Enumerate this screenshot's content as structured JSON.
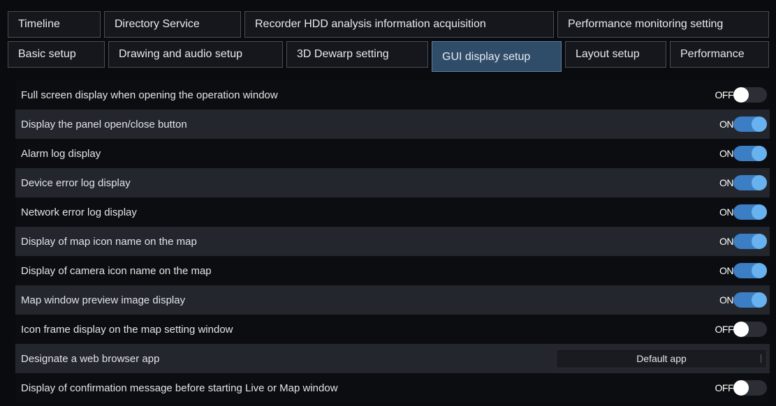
{
  "tabs_row1": [
    {
      "label": "Timeline"
    },
    {
      "label": "Directory Service"
    },
    {
      "label": "Recorder HDD analysis information acquisition"
    },
    {
      "label": "Performance monitoring setting"
    }
  ],
  "tabs_row2": [
    {
      "label": "Basic setup"
    },
    {
      "label": "Drawing and audio setup"
    },
    {
      "label": "3D Dewarp setting"
    },
    {
      "label": "GUI display setup",
      "active": true
    },
    {
      "label": "Layout setup"
    },
    {
      "label": "Performance"
    }
  ],
  "settings": [
    {
      "label": "Full screen display when opening the operation window",
      "type": "toggle",
      "state": "OFF"
    },
    {
      "label": "Display the panel open/close button",
      "type": "toggle",
      "state": "ON"
    },
    {
      "label": "Alarm log display",
      "type": "toggle",
      "state": "ON"
    },
    {
      "label": "Device error log display",
      "type": "toggle",
      "state": "ON"
    },
    {
      "label": "Network error log display",
      "type": "toggle",
      "state": "ON"
    },
    {
      "label": "Display of map icon name on the map",
      "type": "toggle",
      "state": "ON"
    },
    {
      "label": "Display of camera icon name on the map",
      "type": "toggle",
      "state": "ON"
    },
    {
      "label": "Map window preview image display",
      "type": "toggle",
      "state": "ON"
    },
    {
      "label": "Icon frame display on the map setting window",
      "type": "toggle",
      "state": "OFF"
    },
    {
      "label": "Designate a web browser app",
      "type": "select",
      "value": "Default app"
    },
    {
      "label": "Display of confirmation message before starting Live or Map window",
      "type": "toggle",
      "state": "OFF"
    }
  ],
  "colors": {
    "background": "#0a0b0e",
    "active_tab": "#2f4d69",
    "toggle_on": "#3c7ec4",
    "toggle_off": "#2b2e35"
  }
}
